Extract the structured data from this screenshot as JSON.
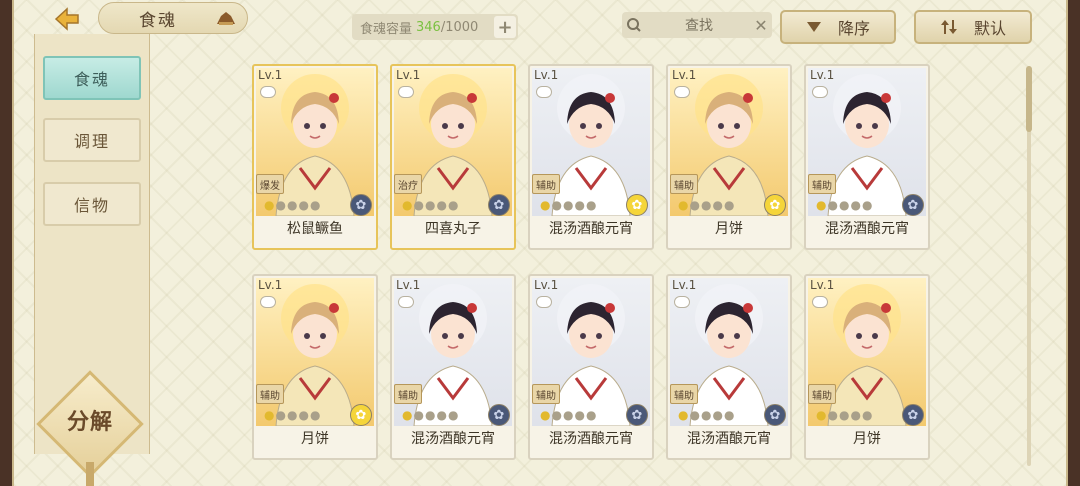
{
  "header": {
    "title": "食魂",
    "capacity_label": "食魂容量",
    "capacity_current": "346",
    "capacity_max": "/1000",
    "search_placeholder": "查找",
    "sort_order": "降序",
    "sort_mode": "默认"
  },
  "sidebar": {
    "items": [
      {
        "label": "食魂",
        "active": true
      },
      {
        "label": "调理",
        "active": false
      },
      {
        "label": "信物",
        "active": false
      }
    ],
    "decompose_label": "分解"
  },
  "cards": [
    {
      "level": "Lv.1",
      "role": "爆发",
      "name": "松鼠鳜鱼",
      "emblem": "dark",
      "theme": "gold"
    },
    {
      "level": "Lv.1",
      "role": "治疗",
      "name": "四喜丸子",
      "emblem": "dark",
      "theme": "gold"
    },
    {
      "level": "Lv.1",
      "role": "辅助",
      "name": "混汤酒酿元宵",
      "emblem": "yellow",
      "theme": "white"
    },
    {
      "level": "Lv.1",
      "role": "辅助",
      "name": "月饼",
      "emblem": "yellow",
      "theme": "gold"
    },
    {
      "level": "Lv.1",
      "role": "辅助",
      "name": "混汤酒酿元宵",
      "emblem": "dark",
      "theme": "white"
    },
    {
      "level": "Lv.1",
      "role": "辅助",
      "name": "月饼",
      "emblem": "yellow",
      "theme": "gold"
    },
    {
      "level": "Lv.1",
      "role": "辅助",
      "name": "混汤酒酿元宵",
      "emblem": "dark",
      "theme": "white"
    },
    {
      "level": "Lv.1",
      "role": "辅助",
      "name": "混汤酒酿元宵",
      "emblem": "dark",
      "theme": "white"
    },
    {
      "level": "Lv.1",
      "role": "辅助",
      "name": "混汤酒酿元宵",
      "emblem": "dark",
      "theme": "white"
    },
    {
      "level": "Lv.1",
      "role": "辅助",
      "name": "月饼",
      "emblem": "dark",
      "theme": "gold"
    }
  ]
}
